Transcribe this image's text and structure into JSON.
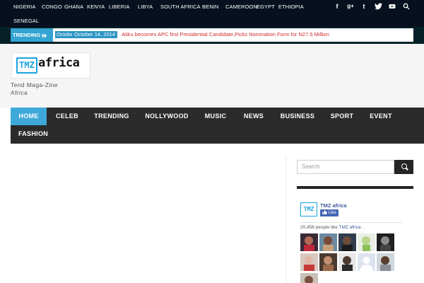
{
  "countries": [
    "NIGERIA",
    "CONGO",
    "GHANA",
    "KENYA",
    "LIBERIA",
    "LIBYA",
    "SOUTH AFRICA",
    "BENIN",
    "CAMEROON",
    "EGYPT",
    "ETHIOPIA",
    "SENEGAL"
  ],
  "social_icons": [
    "facebook-icon",
    "google-plus-icon",
    "tumblr-icon",
    "twitter-icon",
    "youtube-icon",
    "search-icon"
  ],
  "trending": {
    "label": "TRENDING",
    "date_partial": "October",
    "date": "October 14, 2014",
    "headline": "Atiku becomes APC first Presidential Candidate,Picks Nomination Form for N27.5 Million"
  },
  "logo": {
    "tmz": "TMZ",
    "africa": "africa"
  },
  "tagline": "Tend Maga-Zine Africa",
  "nav": [
    "HOME",
    "CELEB",
    "TRENDING",
    "NOLLYWOOD",
    "MUSIC",
    "NEWS",
    "BUSINESS",
    "SPORT",
    "EVENT",
    "FASHION"
  ],
  "search": {
    "placeholder": "Search"
  },
  "facebook": {
    "page_name": "TMZ africa",
    "like_label": "Like",
    "count_text": "20,458 people like",
    "count_link": "TMZ africa ."
  },
  "colors": {
    "accent": "#3ea9d9",
    "topbar": "#06101f",
    "nav": "#2b2b2b"
  }
}
